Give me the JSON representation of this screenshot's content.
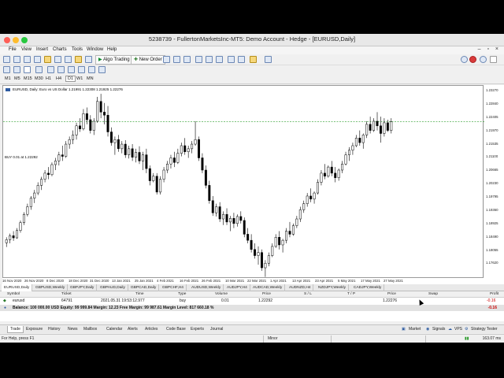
{
  "window": {
    "title": "5238739 - FullertonMarketsInc-MT5: Demo Account - Hedge - [EURUSD,Daily]"
  },
  "menu": {
    "items": [
      "File",
      "View",
      "Insert",
      "Charts",
      "Tools",
      "Window",
      "Help"
    ]
  },
  "toolbar": {
    "algo_trading_label": "Algo Trading",
    "new_order_label": "New Order"
  },
  "timeframes": [
    "M1",
    "M5",
    "M15",
    "M30",
    "H1",
    "H4",
    "D1",
    "W1",
    "MN"
  ],
  "selected_timeframe": "D1",
  "chart": {
    "info": "EURUSD, Daily:  Euro vs US Dollar  1.21991 1.22308 1.21925 1.22276",
    "buy_label": "BUY 0.01 at 1.22292"
  },
  "chart_data": {
    "type": "candlestick",
    "symbol": "EURUSD",
    "timeframe": "Daily",
    "y_ticks": [
      "1.23270",
      "1.22840",
      "1.22405",
      "1.21970",
      "1.21535",
      "1.21100",
      "1.20665",
      "1.20230",
      "1.19795",
      "1.19360",
      "1.18925",
      "1.18490",
      "1.18055",
      "1.17620"
    ],
    "ylim": [
      1.1714,
      1.2346
    ],
    "x_ticks": [
      "16 Nov 2020",
      "26 Nov 2020",
      "8 Dec 2020",
      "18 Dec 2020",
      "31 Dec 2020",
      "13 Jan 2021",
      "25 Jan 2021",
      "4 Feb 2021",
      "16 Feb 2021",
      "26 Feb 2021",
      "10 Mar 2021",
      "22 Mar 2021",
      "1 Apr 2021",
      "13 Apr 2021",
      "23 Apr 2021",
      "5 May 2021",
      "17 May 2021",
      "27 May 2021"
    ],
    "buy_line": 1.22292,
    "candles": [
      [
        1.1832,
        1.185,
        1.1818,
        1.1842
      ],
      [
        1.1842,
        1.1862,
        1.183,
        1.1855
      ],
      [
        1.1855,
        1.187,
        1.1838,
        1.1848
      ],
      [
        1.1848,
        1.188,
        1.1845,
        1.1872
      ],
      [
        1.1872,
        1.1905,
        1.1865,
        1.1898
      ],
      [
        1.1898,
        1.1932,
        1.189,
        1.1925
      ],
      [
        1.1925,
        1.196,
        1.1918,
        1.195
      ],
      [
        1.195,
        1.1985,
        1.194,
        1.1978
      ],
      [
        1.1978,
        1.2005,
        1.1962,
        1.1995
      ],
      [
        1.1995,
        1.203,
        1.1988,
        1.202
      ],
      [
        1.202,
        1.2048,
        1.2005,
        1.204
      ],
      [
        1.204,
        1.207,
        1.203,
        1.206
      ],
      [
        1.206,
        1.208,
        1.204,
        1.2055
      ],
      [
        1.2055,
        1.2095,
        1.205,
        1.2088
      ],
      [
        1.2088,
        1.211,
        1.207,
        1.21
      ],
      [
        1.21,
        1.213,
        1.2085,
        1.212
      ],
      [
        1.212,
        1.215,
        1.21,
        1.2115
      ],
      [
        1.2115,
        1.2165,
        1.211,
        1.2155
      ],
      [
        1.2155,
        1.218,
        1.214,
        1.217
      ],
      [
        1.217,
        1.22,
        1.2155,
        1.2185
      ],
      [
        1.2185,
        1.2225,
        1.217,
        1.2215
      ],
      [
        1.2215,
        1.224,
        1.2195,
        1.2205
      ],
      [
        1.2205,
        1.227,
        1.22,
        1.2255
      ],
      [
        1.2255,
        1.2275,
        1.222,
        1.2235
      ],
      [
        1.2235,
        1.225,
        1.219,
        1.22
      ],
      [
        1.22,
        1.224,
        1.2185,
        1.223
      ],
      [
        1.223,
        1.231,
        1.2225,
        1.2295
      ],
      [
        1.2295,
        1.232,
        1.224,
        1.226
      ],
      [
        1.226,
        1.229,
        1.222,
        1.225
      ],
      [
        1.225,
        1.228,
        1.218,
        1.2195
      ],
      [
        1.2195,
        1.221,
        1.215,
        1.216
      ],
      [
        1.216,
        1.218,
        1.212,
        1.217
      ],
      [
        1.217,
        1.2185,
        1.213,
        1.214
      ],
      [
        1.214,
        1.2165,
        1.2125,
        1.2155
      ],
      [
        1.2155,
        1.2168,
        1.211,
        1.212
      ],
      [
        1.212,
        1.215,
        1.2108,
        1.214
      ],
      [
        1.214,
        1.2155,
        1.21,
        1.2112
      ],
      [
        1.2112,
        1.214,
        1.2095,
        1.2128
      ],
      [
        1.2128,
        1.2148,
        1.209,
        1.21
      ],
      [
        1.21,
        1.213,
        1.207,
        1.212
      ],
      [
        1.212,
        1.214,
        1.206,
        1.2075
      ],
      [
        1.2075,
        1.2085,
        1.202,
        1.2035
      ],
      [
        1.2035,
        1.206,
        1.203,
        1.205
      ],
      [
        1.205,
        1.206,
        1.199,
        1.1998
      ],
      [
        1.1998,
        1.205,
        1.199,
        1.204
      ],
      [
        1.204,
        1.208,
        1.203,
        1.207
      ],
      [
        1.207,
        1.21,
        1.206,
        1.209
      ],
      [
        1.209,
        1.212,
        1.2075,
        1.211
      ],
      [
        1.211,
        1.213,
        1.208,
        1.2095
      ],
      [
        1.2095,
        1.214,
        1.209,
        1.2125
      ],
      [
        1.2125,
        1.216,
        1.2115,
        1.215
      ],
      [
        1.215,
        1.2175,
        1.212,
        1.213
      ],
      [
        1.213,
        1.215,
        1.211,
        1.214
      ],
      [
        1.214,
        1.2165,
        1.2125,
        1.2155
      ],
      [
        1.2155,
        1.223,
        1.215,
        1.217
      ],
      [
        1.217,
        1.218,
        1.21,
        1.211
      ],
      [
        1.211,
        1.2125,
        1.206,
        1.207
      ],
      [
        1.207,
        1.2085,
        1.201,
        1.202
      ],
      [
        1.202,
        1.2035,
        1.196,
        1.197
      ],
      [
        1.197,
        1.1985,
        1.192,
        1.193
      ],
      [
        1.193,
        1.196,
        1.1918,
        1.195
      ],
      [
        1.195,
        1.1965,
        1.19,
        1.191
      ],
      [
        1.191,
        1.1935,
        1.189,
        1.1925
      ],
      [
        1.1925,
        1.1945,
        1.189,
        1.19
      ],
      [
        1.19,
        1.192,
        1.187,
        1.1912
      ],
      [
        1.1912,
        1.193,
        1.188,
        1.1895
      ],
      [
        1.1895,
        1.1925,
        1.1885,
        1.1918
      ],
      [
        1.1918,
        1.1935,
        1.1895,
        1.1905
      ],
      [
        1.1905,
        1.1915,
        1.185,
        1.186
      ],
      [
        1.186,
        1.188,
        1.183,
        1.184
      ],
      [
        1.184,
        1.186,
        1.18,
        1.181
      ],
      [
        1.181,
        1.183,
        1.178,
        1.179
      ],
      [
        1.179,
        1.182,
        1.176,
        1.18
      ],
      [
        1.18,
        1.181,
        1.174,
        1.175
      ],
      [
        1.175,
        1.1775,
        1.172,
        1.1765
      ],
      [
        1.1765,
        1.18,
        1.1755,
        1.179
      ],
      [
        1.179,
        1.183,
        1.1785,
        1.182
      ],
      [
        1.182,
        1.186,
        1.1815,
        1.185
      ],
      [
        1.185,
        1.187,
        1.181,
        1.1825
      ],
      [
        1.1825,
        1.1845,
        1.18,
        1.184
      ],
      [
        1.184,
        1.188,
        1.183,
        1.187
      ],
      [
        1.187,
        1.19,
        1.185,
        1.186
      ],
      [
        1.186,
        1.1895,
        1.1855,
        1.1888
      ],
      [
        1.1888,
        1.192,
        1.188,
        1.191
      ],
      [
        1.191,
        1.195,
        1.19,
        1.194
      ],
      [
        1.194,
        1.197,
        1.193,
        1.196
      ],
      [
        1.196,
        1.1995,
        1.195,
        1.1985
      ],
      [
        1.1985,
        1.201,
        1.1965,
        1.1975
      ],
      [
        1.1975,
        1.2,
        1.196,
        1.1995
      ],
      [
        1.1995,
        1.204,
        1.199,
        1.203
      ],
      [
        1.203,
        1.207,
        1.202,
        1.206
      ],
      [
        1.206,
        1.209,
        1.204,
        1.205
      ],
      [
        1.205,
        1.2085,
        1.2045,
        1.208
      ],
      [
        1.208,
        1.21,
        1.205,
        1.206
      ],
      [
        1.206,
        1.208,
        1.203,
        1.2045
      ],
      [
        1.2045,
        1.2075,
        1.2035,
        1.207
      ],
      [
        1.207,
        1.21,
        1.206,
        1.209
      ],
      [
        1.209,
        1.213,
        1.2085,
        1.212
      ],
      [
        1.212,
        1.2145,
        1.21,
        1.2135
      ],
      [
        1.2135,
        1.216,
        1.212,
        1.215
      ],
      [
        1.215,
        1.2185,
        1.2145,
        1.2175
      ],
      [
        1.2175,
        1.22,
        1.215,
        1.216
      ],
      [
        1.216,
        1.219,
        1.214,
        1.2185
      ],
      [
        1.2185,
        1.223,
        1.2175,
        1.222
      ],
      [
        1.222,
        1.2245,
        1.219,
        1.22
      ],
      [
        1.22,
        1.224,
        1.2195,
        1.223
      ],
      [
        1.223,
        1.226,
        1.22,
        1.2215
      ],
      [
        1.2215,
        1.2245,
        1.216,
        1.219
      ],
      [
        1.219,
        1.224,
        1.218,
        1.2225
      ],
      [
        1.2225,
        1.2235,
        1.2195,
        1.22
      ],
      [
        1.22,
        1.224,
        1.219,
        1.2228
      ]
    ]
  },
  "symbol_tabs": [
    "EURUSD,Daily",
    "GBPUSD,Weekly",
    "GBPJPY,Daily",
    "GBPAUD,Daily",
    "GBPCAD,Daily",
    "GBPCHF,H4",
    "AUDUSD,Weekly",
    "AUDJPY,H4",
    "AUDCAD,Weekly",
    "AUDNZD,H4",
    "NZDJPY,Weekly",
    "CADJPY,Weekly"
  ],
  "terminal": {
    "headers": {
      "symbol": "Symbol",
      "ticket": "Ticket",
      "time": "Time",
      "type": "Type",
      "volume": "Volume",
      "price": "Price",
      "sl": "S / L",
      "tp": "T / P",
      "price2": "Price",
      "swap": "Swap",
      "profit": "Profit"
    },
    "row": {
      "symbol": "eurusd",
      "ticket": "64791",
      "time": "2021.05.31 19:53:12.977",
      "type": "buy",
      "volume": "0.01",
      "price": "1.22292",
      "price2": "1.22276",
      "profit": "-0.16"
    },
    "balance_line": "Balance: 100 000.00 USD   Equity: 99 999.84   Margin: 12.23   Free Margin: 99 987.61   Margin Level: 817 660.18 %",
    "balance_total": "-0.16"
  },
  "bottom_tabs": [
    "Trade",
    "Exposure",
    "History",
    "News",
    "Mailbox",
    "Calendar",
    "Alerts",
    "Articles",
    "Code Base",
    "Experts",
    "Journal"
  ],
  "right_tabs": [
    "Market",
    "Signals",
    "VPS",
    "Strategy Tester"
  ],
  "status": {
    "help": "For Help, press F1",
    "profile": "Minor",
    "connection": "163.07 ms"
  }
}
